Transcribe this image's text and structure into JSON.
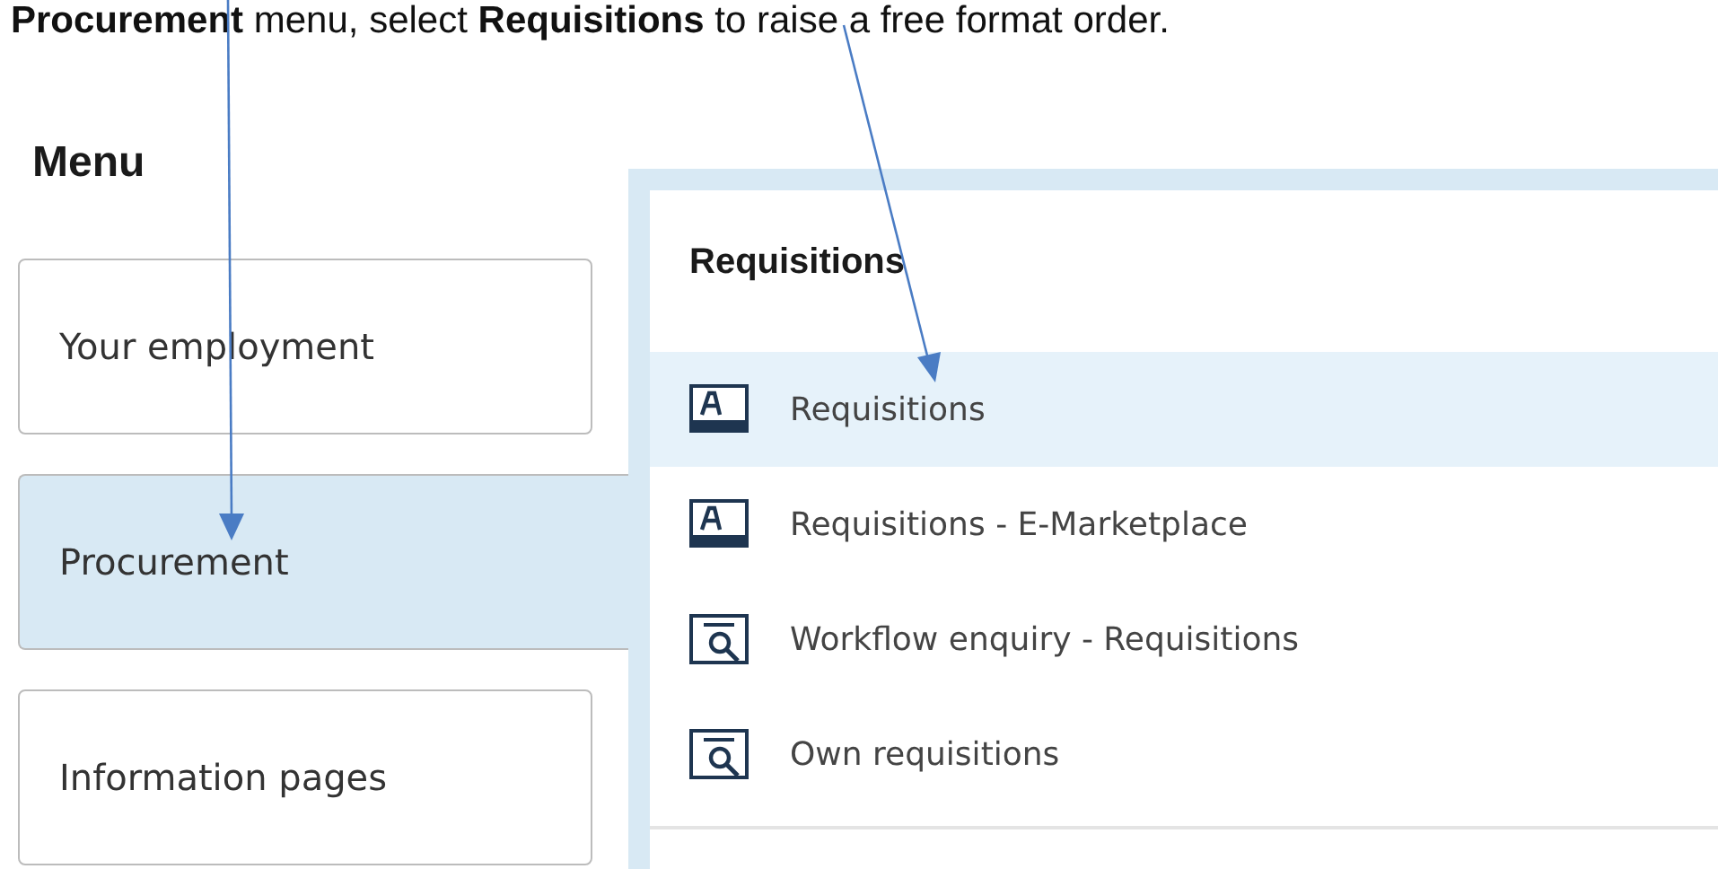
{
  "instruction": "**Procurement** menu, select **Requisitions** to raise a free format order.",
  "menu": {
    "title": "Menu",
    "items": [
      {
        "label": "Your employment",
        "selected": false
      },
      {
        "label": "Procurement",
        "selected": true
      },
      {
        "label": "Information pages",
        "selected": false
      }
    ]
  },
  "panel": {
    "title": "Requisitions",
    "items": [
      {
        "label": "Requisitions",
        "kind": "form",
        "selected": true
      },
      {
        "label": "Requisitions - E-Marketplace",
        "kind": "form",
        "selected": false
      },
      {
        "label": "Workflow enquiry - Requisitions",
        "kind": "enquiry",
        "selected": false
      },
      {
        "label": "Own requisitions",
        "kind": "enquiry",
        "selected": false
      }
    ]
  }
}
